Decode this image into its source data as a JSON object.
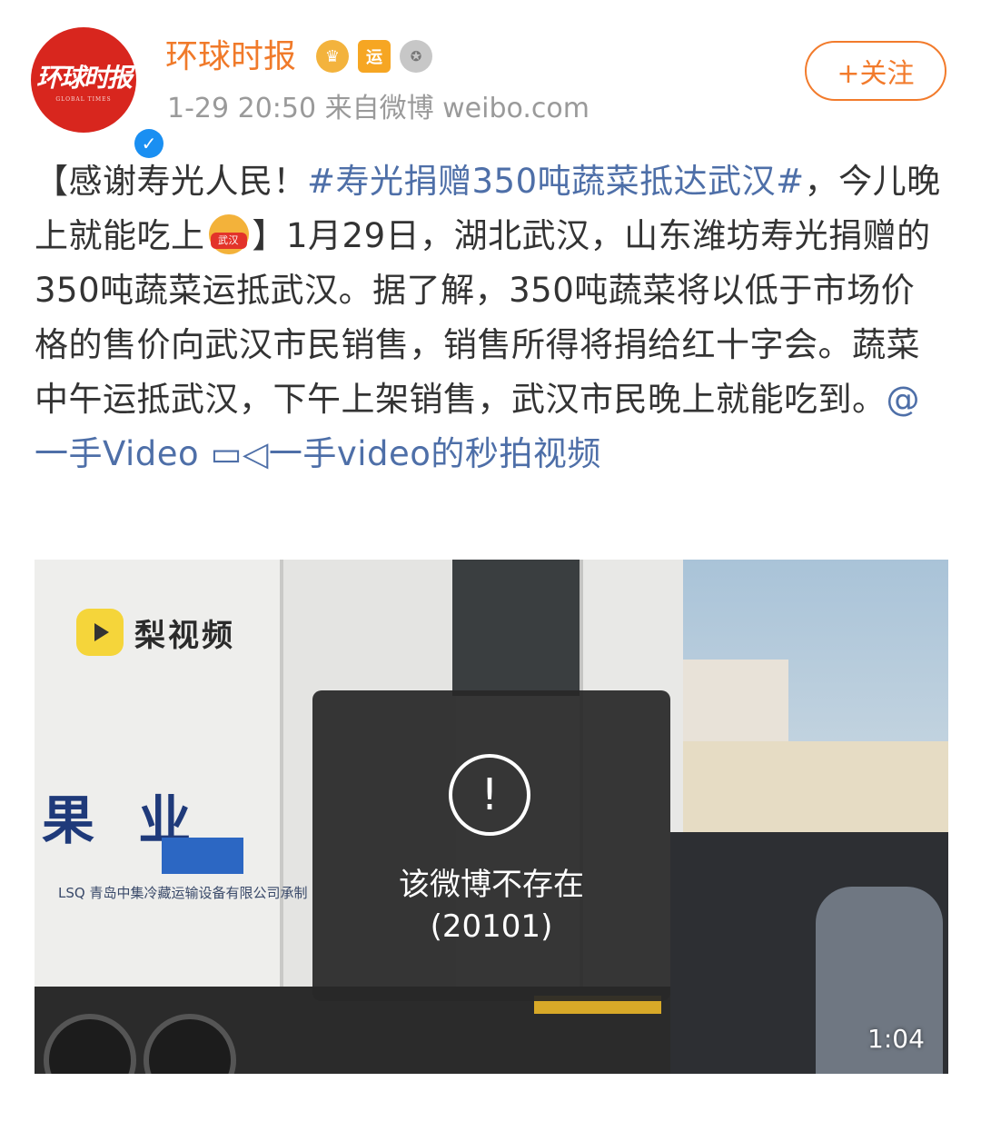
{
  "post": {
    "avatar_logo_text": "环球时报",
    "avatar_logo_sub": "GLOBAL TIMES",
    "verified_mark": "✓",
    "username": "环球时报",
    "badges": [
      {
        "icon": "crown-badge-icon",
        "glyph": "♛",
        "color": "#f3b33d"
      },
      {
        "icon": "yun-badge-icon",
        "glyph": "运",
        "color": "#f6a623"
      },
      {
        "icon": "medal-badge-icon",
        "glyph": "✪",
        "color": "#c7c7c7"
      }
    ],
    "meta": "1-29 20:50  来自微博 weibo.com",
    "follow_label": "+关注",
    "text_part1": "【感谢寿光人民！",
    "hashtag": "#寿光捐赠350吨蔬菜抵达武汉#",
    "text_part2": "，今儿晚上就能吃上",
    "emoji_tag": "武汉",
    "text_part3": "】1月29日，湖北武汉，山东潍坊寿光捐赠的350吨蔬菜运抵武汉。据了解，350吨蔬菜将以低于市场价格的售价向武汉市民销售，销售所得将捐给红十字会。蔬菜中午运抵武汉，下午上架销售，武汉市民晚上就能吃到。",
    "mention_link": "@一手Video",
    "video_link": "一手video的秒拍视频",
    "video_link_icon": "video-camera-icon"
  },
  "video": {
    "watermark_text": "梨视频",
    "truck_text": "果 业",
    "truck_company": "LSQ 青岛中集冷藏运输设备有限公司承制",
    "error_icon": "!",
    "error_message": "该微博不存在",
    "error_code": "(20101)",
    "duration": "1:04"
  },
  "colors": {
    "accent_orange": "#f07a2a",
    "link_blue": "#4e6fa8",
    "verified_blue": "#1a8ff2",
    "avatar_red": "#d8261e"
  }
}
